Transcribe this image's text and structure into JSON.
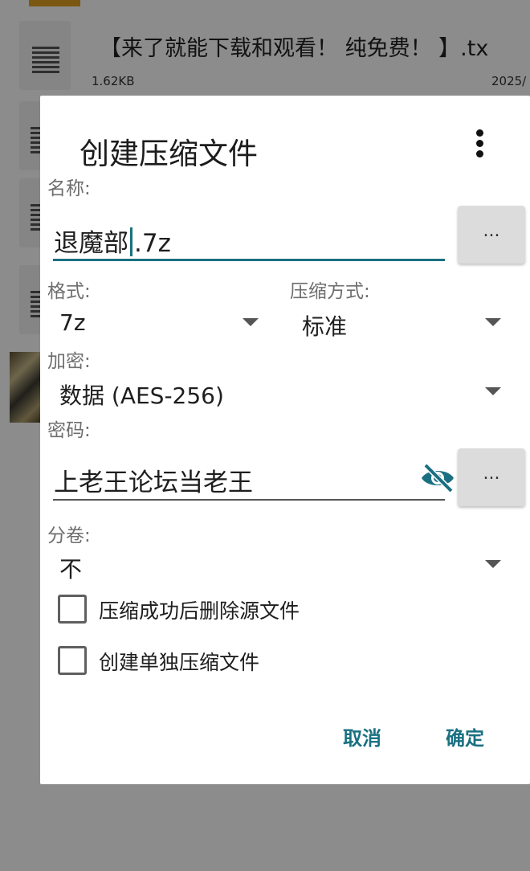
{
  "background": {
    "file_name": "【来了就能下载和观看！ 纯免费！ 】.tx",
    "file_size": "1.62KB",
    "file_date": "2025/"
  },
  "dialog": {
    "title": "创建压缩文件",
    "menu_icon": "more-vert-icon",
    "name_label": "名称:",
    "name_value_before_cursor": "退魔部",
    "name_value_after_cursor": ".7z",
    "browse_label": "...",
    "format_label": "格式:",
    "format_value": "7z",
    "compression_label": "压缩方式:",
    "compression_value": "标准",
    "encryption_label": "加密:",
    "encryption_value": "数据 (AES-256)",
    "password_label": "密码:",
    "password_value": "上老王论坛当老王",
    "password_visibility_icon": "visibility-off-icon",
    "password_browse_label": "...",
    "split_label": "分卷:",
    "split_value": "不",
    "delete_source_label": "压缩成功后删除源文件",
    "delete_source_checked": false,
    "separate_archives_label": "创建单独压缩文件",
    "separate_archives_checked": false,
    "cancel_label": "取消",
    "ok_label": "确定"
  },
  "colors": {
    "accent": "#1a7081",
    "scrim": "rgba(0,0,0,0.45)",
    "folder": "#e0a020"
  }
}
